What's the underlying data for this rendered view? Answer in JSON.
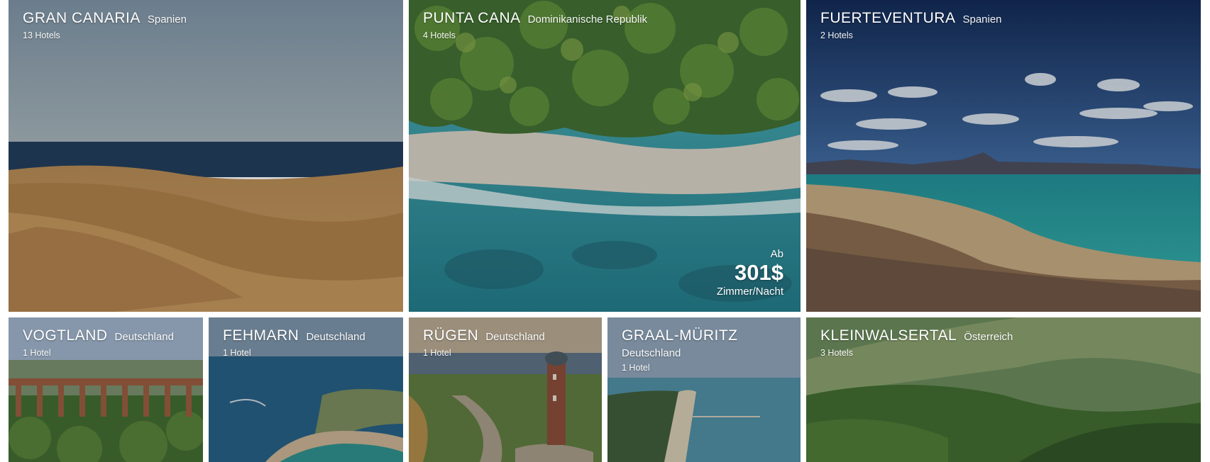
{
  "destinations": [
    {
      "name": "GRAN CANARIA",
      "country": "Spanien",
      "count": "13 Hotels"
    },
    {
      "name": "PUNTA CANA",
      "country": "Dominikanische Republik",
      "count": "4 Hotels",
      "price": {
        "from": "Ab",
        "amount": "301$",
        "unit": "Zimmer/Nacht"
      }
    },
    {
      "name": "FUERTEVENTURA",
      "country": "Spanien",
      "count": "2 Hotels"
    },
    {
      "name": "VOGTLAND",
      "country": "Deutschland",
      "count": "1 Hotel"
    },
    {
      "name": "FEHMARN",
      "country": "Deutschland",
      "count": "1 Hotel"
    },
    {
      "name": "RÜGEN",
      "country": "Deutschland",
      "count": "1 Hotel"
    },
    {
      "name": "GRAAL-MÜRITZ",
      "country": "Deutschland",
      "count": "1 Hotel"
    },
    {
      "name": "KLEINWALSERTAL",
      "country": "Österreich",
      "count": "3 Hotels"
    }
  ]
}
